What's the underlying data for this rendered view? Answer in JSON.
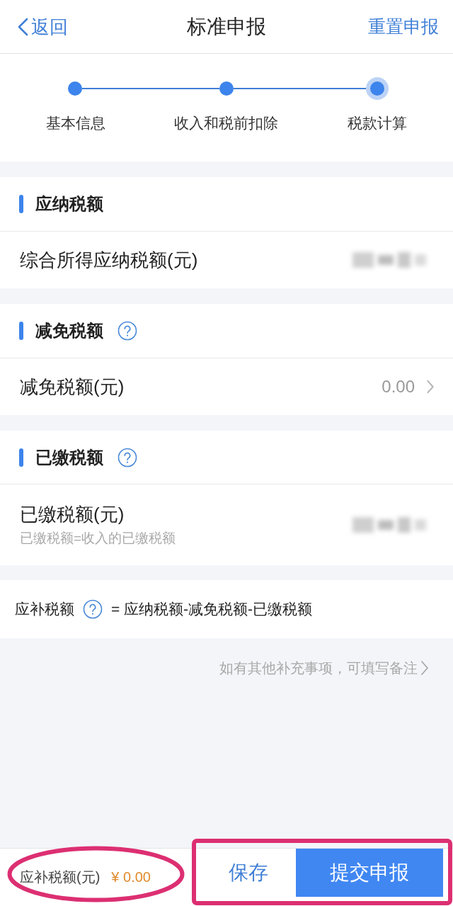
{
  "nav": {
    "back": "返回",
    "title": "标准申报",
    "action": "重置申报"
  },
  "steps": [
    {
      "label": "基本信息",
      "selected": false
    },
    {
      "label": "收入和税前扣除",
      "selected": false
    },
    {
      "label": "税款计算",
      "selected": true
    }
  ],
  "sections": [
    {
      "title": "应纳税额",
      "help": false,
      "rows": [
        {
          "kind": "blurred",
          "label": "综合所得应纳税额(元)"
        }
      ]
    },
    {
      "title": "减免税额",
      "help": true,
      "rows": [
        {
          "kind": "link",
          "label": "减免税额(元)",
          "value": "0.00"
        }
      ]
    },
    {
      "title": "已缴税额",
      "help": true,
      "rows": [
        {
          "kind": "blurred",
          "label": "已缴税额(元)",
          "hint": "已缴税额=收入的已缴税额"
        }
      ]
    }
  ],
  "formula": {
    "label": "应补税额",
    "text": "= 应纳税额-减免税额-已缴税额"
  },
  "note": "如有其他补充事项，可填写备注",
  "footer": {
    "total": {
      "label": "应补税额(元)",
      "amount": "¥ 0.00",
      "circled": true
    },
    "buttons_boxed": true,
    "buttons": [
      {
        "label": "保存",
        "kind": "secondary"
      },
      {
        "label": "提交申报",
        "kind": "primary"
      }
    ]
  }
}
